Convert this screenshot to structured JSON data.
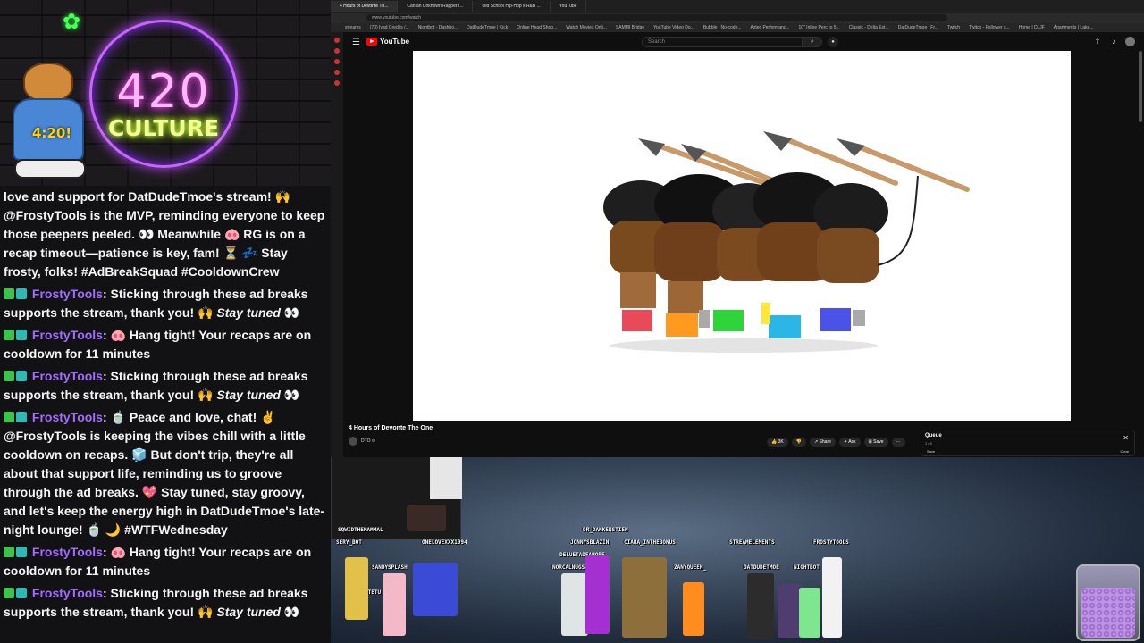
{
  "overlay": {
    "neon_number": "420",
    "neon_word": "CULTURE",
    "bear_time": "4:20!"
  },
  "chat": {
    "messages": [
      {
        "text": "love and support for DatDudeTmoe's stream! 🙌 @FrostyTools is the MVP, reminding everyone to keep those peepers peeled. 👀 Meanwhile 🐽 RG is on a recap timeout—patience is key, fam! ⏳ 💤 Stay frosty, folks! #AdBreakSquad #CooldownCrew"
      },
      {
        "user": "FrostyTools",
        "text": ": Sticking through these ad breaks supports the stream, thank you! 🙌 ",
        "italic": "Stay tuned",
        "tail": " 👀"
      },
      {
        "user": "FrostyTools",
        "text": ": 🐽 Hang tight! Your recaps are on cooldown for 11 minutes"
      },
      {
        "user": "FrostyTools",
        "text": ": Sticking through these ad breaks supports the stream, thank you! 🙌 ",
        "italic": "Stay tuned",
        "tail": " 👀"
      },
      {
        "user": "FrostyTools",
        "text": ": 🍵 Peace and love, chat! ✌ @FrostyTools is keeping the vibes chill with a little cooldown on recaps. 🧊 But don't trip, they're all about that support life, reminding us to groove through the ad breaks. 💖 Stay tuned, stay groovy, and let's keep the energy high in DatDudeTmoe's late-night lounge! 🍵 🌙 #WTFWednesday"
      },
      {
        "user": "FrostyTools",
        "text": ": 🐽 Hang tight! Your recaps are on cooldown for 11 minutes"
      },
      {
        "user": "FrostyTools",
        "text": ": Sticking through these ad breaks supports the stream, thank you! 🙌 ",
        "italic": "Stay tuned",
        "tail": " 👀"
      }
    ]
  },
  "browser": {
    "tabs": [
      "4 Hours of Devonte Th...",
      "Can an Unknown Rapper I...",
      "Old School Hip-Hop x R&B ...",
      "YouTube"
    ],
    "url": "www.youtube.com/watch",
    "bookmarks": [
      "streams",
      "(70) Ivad Credits /...",
      "Nightbot - Dashbo...",
      "DatDudeTmoe | Kick",
      "Online Head Shop...",
      "Watch Movies Onli...",
      "SAMMI Bridge",
      "YouTube Video Do...",
      "Bubble | No-code...",
      "Aztec Performanc...",
      "10\" Inline Perc to 5...",
      "Classic - Delta Ext...",
      "DatDudeTmoe | Fr...",
      "Twitch",
      "Twitch - Follower s...",
      "Home | DJJF",
      "Apartments | Lake..."
    ]
  },
  "youtube": {
    "logo": "YouTube",
    "search_placeholder": "Search",
    "video_title": "4 Hours of Devonte The One",
    "channel": "DTO ⊙",
    "actions": [
      "👍 3K",
      "👎",
      "↗ Share",
      "✦ Ask",
      "⊞ Save",
      "···"
    ],
    "queue_title": "Queue",
    "queue_count": "1 / 5",
    "queue_save": "Save",
    "queue_clear": "Clear"
  },
  "stream_names": [
    "SQWIDTHEMAMMAL",
    "SERY_BOT",
    "ONELOVEXXX1994",
    "SANDYSPLASH",
    "LUMENATETU",
    "DR_DANKENSTIEN",
    "JONNYSBLAZIN",
    "CIARA_INTHEBONUS",
    "DELUETADEAMORE",
    "NORCALNUGS",
    "ZANYQUEEN_",
    "STREAMELEMENTS",
    "FROSTYTOOLS",
    "DATDUDETMOE",
    "NIGHTBOT"
  ],
  "colors": {
    "accent_purple": "#a36bff",
    "youtube_red": "#ff0000"
  }
}
